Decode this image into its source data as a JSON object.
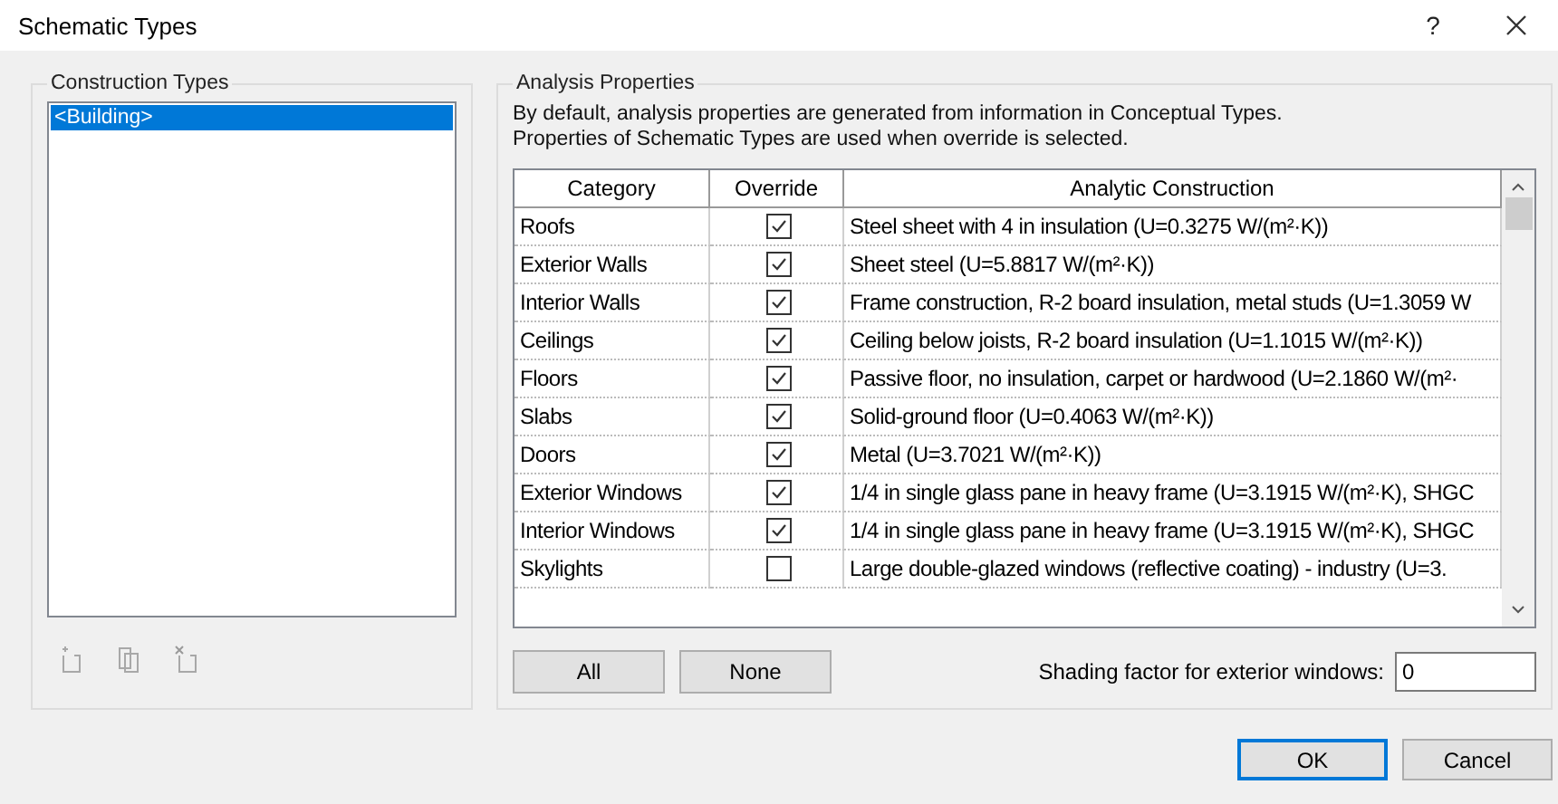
{
  "window": {
    "title": "Schematic Types",
    "help": "?"
  },
  "construction_types": {
    "title": "Construction Types",
    "items": [
      {
        "label": "<Building>",
        "selected": true
      }
    ]
  },
  "analysis_properties": {
    "title": "Analysis Properties",
    "description": [
      "By default, analysis properties are generated from information in Conceptual Types.",
      "Properties of Schematic Types are used when override is selected."
    ],
    "columns": [
      "Category",
      "Override",
      "Analytic Construction"
    ],
    "rows": [
      {
        "category": "Roofs",
        "override": true,
        "construction": "Steel sheet with 4 in insulation (U=0.3275 W/(m²·K))"
      },
      {
        "category": "Exterior Walls",
        "override": true,
        "construction": "Sheet steel (U=5.8817 W/(m²·K))"
      },
      {
        "category": "Interior Walls",
        "override": true,
        "construction": "Frame construction, R-2 board insulation, metal studs (U=1.3059 W"
      },
      {
        "category": "Ceilings",
        "override": true,
        "construction": "Ceiling below joists, R-2 board insulation (U=1.1015 W/(m²·K))"
      },
      {
        "category": "Floors",
        "override": true,
        "construction": "Passive floor, no insulation, carpet or hardwood (U=2.1860 W/(m²·"
      },
      {
        "category": "Slabs",
        "override": true,
        "construction": "Solid-ground floor (U=0.4063 W/(m²·K))"
      },
      {
        "category": "Doors",
        "override": true,
        "construction": "Metal (U=3.7021 W/(m²·K))"
      },
      {
        "category": "Exterior Windows",
        "override": true,
        "construction": "1/4 in single glass pane in heavy frame (U=3.1915 W/(m²·K), SHGC"
      },
      {
        "category": "Interior Windows",
        "override": true,
        "construction": "1/4 in single glass pane in heavy frame (U=3.1915 W/(m²·K), SHGC"
      },
      {
        "category": "Skylights",
        "override": false,
        "construction": "Large double-glazed windows (reflective coating) - industry (U=3."
      }
    ],
    "buttons": [
      "All",
      "None"
    ],
    "shading": {
      "label": "Shading factor for exterior windows:",
      "value": "0"
    }
  },
  "footer_buttons": [
    {
      "label": "OK",
      "default": true
    },
    {
      "label": "Cancel",
      "default": false
    }
  ]
}
